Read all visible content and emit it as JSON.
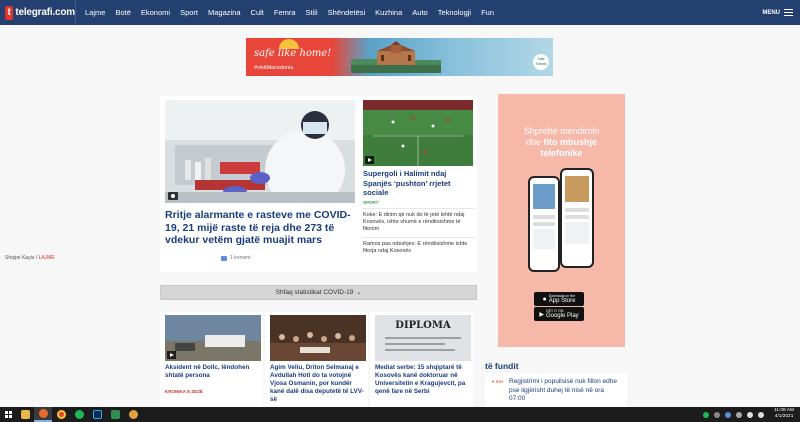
{
  "nav": {
    "logo_text": "telegrafi.com",
    "items": [
      "Lajme",
      "Botë",
      "Ekonomi",
      "Sport",
      "Magazina",
      "Cult",
      "Femra",
      "Stili",
      "Shëndetësi",
      "Kuzhina",
      "Auto",
      "Teknologji",
      "Fun"
    ],
    "menu_label": "MENU"
  },
  "top_ad": {
    "headline": "safe like home!",
    "hashtag": "#visitMacedonia",
    "badge": "Safe Travels"
  },
  "main_story": {
    "title": "Rritje alarmante e rasteve me COVID-19, 21 mijë raste të reja dhe 273 të vdekur vetëm gjatë muajit mars",
    "author": "Shqipe Kaçiu",
    "category": "LAJME",
    "comments": "1 koment"
  },
  "side_story": {
    "title": "Supergoli i Halimit ndaj Spanjës ‘pushton’ rrjetet sociale",
    "category": "SPORT",
    "related": [
      "Koke: E dinim që nuk do të jetë lehtë ndaj Kosovës, ishte shumë e rëndësishme të fitonim",
      "Ramos pas ndeshjes: E rëndësishme ishte fitorja ndaj Kosovës"
    ]
  },
  "stats_bar": {
    "label": "Shfaq statistikat COVID-19"
  },
  "bottom_stories": [
    {
      "title": "Aksident në Dollc, lëndohen shtatë persona",
      "category": "KRONIKA E ZEZË"
    },
    {
      "title": "Agim Veliu, Driton Selmanaj e Avdullah Hoti do ta votojnë Vjosa Osmanin, por kundër kanë dalë disa deputetë të LVV-së",
      "category": ""
    },
    {
      "title": "Mediat serbe: 15 shqiptarë të Kosovës kanë doktoruar në Universitetin e Kragujevcit, pa qenë fare në Serbi",
      "category": ""
    }
  ],
  "bottom_photo_text": "DIPLOMA",
  "right_ad": {
    "line1": "Shprehe mendimin",
    "line2_prefix": "dhe",
    "line2_bold": "fito mbushje",
    "line3": "telefonike",
    "app_store_small": "Download on the",
    "app_store": "App Store",
    "google_small": "GET IT ON",
    "google": "Google Play"
  },
  "latest": {
    "heading": "të fundit",
    "items": [
      {
        "time": "6 min",
        "text": "Regjistrimi i popullsisë nuk fillon edhe pse ligjërisht duhej të nisë në ora 07:00"
      }
    ]
  },
  "taskbar": {
    "time": "11:08 AM",
    "date": "4/1/2021"
  },
  "colors": {
    "nav_bg": "#234070",
    "headline": "#1a3d7c",
    "accent_red": "#d0342c",
    "sport_green": "#3aa24c",
    "ad_pink": "#f6b8a8"
  }
}
